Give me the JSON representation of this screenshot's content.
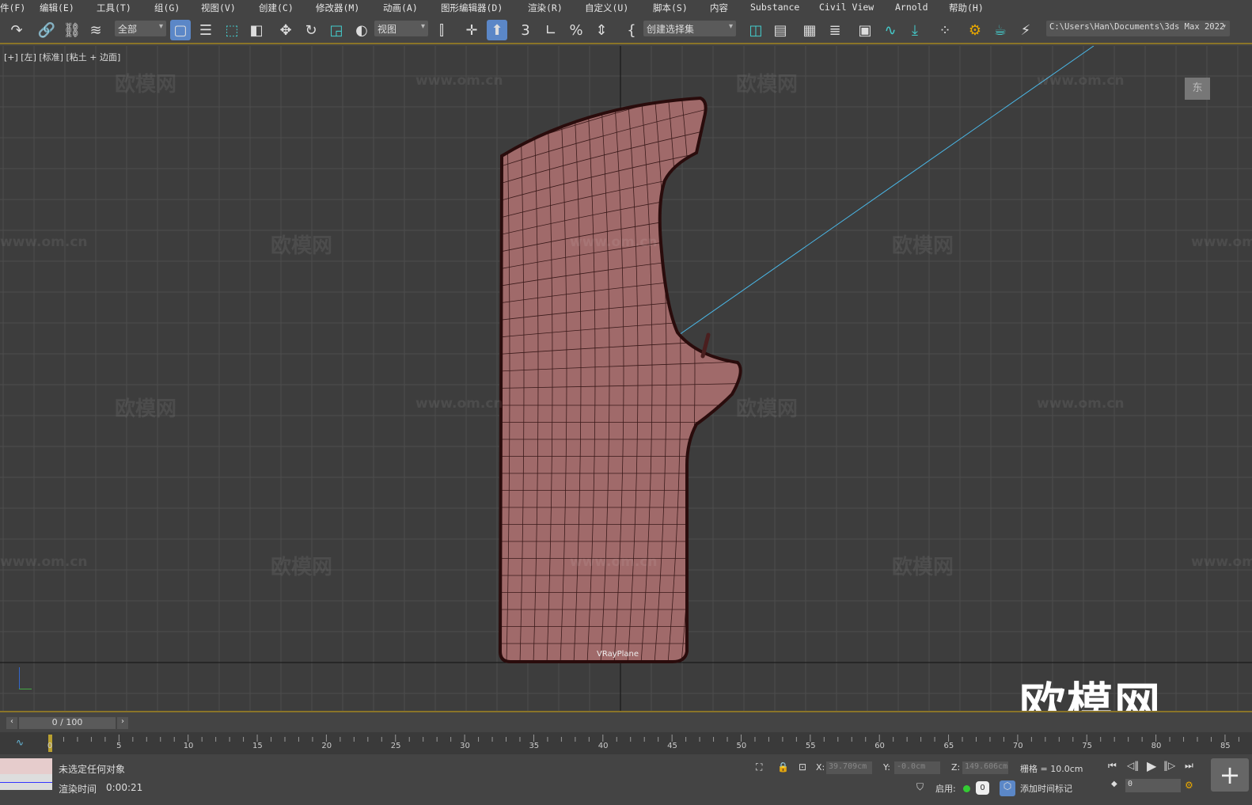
{
  "menu": [
    "件(F)",
    "编辑(E)",
    "工具(T)",
    "组(G)",
    "视图(V)",
    "创建(C)",
    "修改器(M)",
    "动画(A)",
    "图形编辑器(D)",
    "渲染(R)",
    "自定义(U)",
    "脚本(S)",
    "内容",
    "Substance",
    "Civil View",
    "Arnold",
    "帮助(H)"
  ],
  "toolbar": {
    "selection_filter": "全部",
    "ref_coord": "视图",
    "named_selection": "创建选择集",
    "project_path": "C:\\Users\\Han\\Documents\\3ds Max 2022",
    "snap_angle_label": "3"
  },
  "viewport": {
    "label": "[+] [左] [标准] [粘土 + 边面]",
    "object_label": "VRayPlane",
    "viewcube_label": "东",
    "watermark_text": "欧模网",
    "watermark_url": "www.om.cn",
    "logo_text": "欧模网"
  },
  "timeline": {
    "frame_display": "0 / 100",
    "ticks": [
      "0",
      "5",
      "10",
      "15",
      "20",
      "25",
      "30",
      "35",
      "40",
      "45",
      "50",
      "55",
      "60",
      "65",
      "70",
      "75",
      "80",
      "85"
    ]
  },
  "status": {
    "selection": "未选定任何对象",
    "render_time_label": "渲染时间",
    "render_time": "0:00:21",
    "x_label": "X:",
    "x": "39.709cm",
    "y_label": "Y:",
    "y": "-0.0cm",
    "z_label": "Z:",
    "z": "149.606cm",
    "grid": "栅格 = 10.0cm",
    "enable_label": "启用:",
    "enable_count": "0",
    "add_time_tag": "添加时间标记",
    "current_frame": "0"
  },
  "colors": {
    "accent": "#5b87c7",
    "mesh_fill": "#a06a6a",
    "mesh_edge": "#3a1212",
    "viewport_bg": "#3d3d3d",
    "timeline_border": "#8a7428"
  }
}
